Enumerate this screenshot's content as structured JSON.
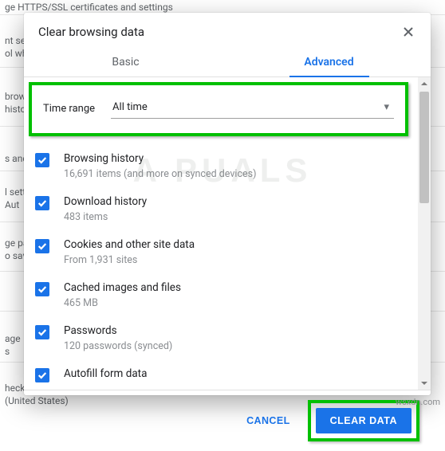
{
  "background": {
    "line_ssl": "ge HTTPS/SSL certificates and settings",
    "line_what": "ol wha",
    "line_brow": "brow",
    "line_histo": "histo",
    "line_s_anc": "s anc",
    "line_sett": "l sett",
    "line_aut": " Aut",
    "line_gepa": "ge pa",
    "line_o_sav": "o sav",
    "line_age": "age",
    "line_s": "s",
    "line_heck": "heck",
    "line_united": "  (United States)",
    "line_nt_set": "nt set"
  },
  "dialog": {
    "title": "Clear browsing data",
    "tabs": {
      "basic": "Basic",
      "advanced": "Advanced"
    },
    "time_range": {
      "label": "Time range",
      "value": "All time"
    },
    "items": [
      {
        "title": "Browsing history",
        "sub": "16,691 items (and more on synced devices)"
      },
      {
        "title": "Download history",
        "sub": "483 items"
      },
      {
        "title": "Cookies and other site data",
        "sub": "From 1,931 sites"
      },
      {
        "title": "Cached images and files",
        "sub": "465 MB"
      },
      {
        "title": "Passwords",
        "sub": "120 passwords (synced)"
      },
      {
        "title": "Autofill form data",
        "sub": ""
      }
    ],
    "footer": {
      "cancel": "CANCEL",
      "clear": "CLEAR DATA"
    }
  },
  "watermark": "A  PUALS",
  "credit": "wsxdn.com"
}
